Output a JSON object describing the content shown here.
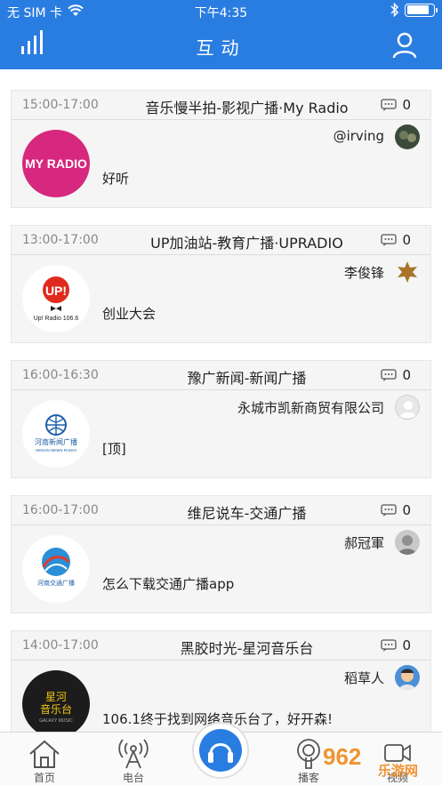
{
  "status": {
    "carrier": "无 SIM 卡",
    "time": "下午4:35"
  },
  "nav": {
    "title": "互动",
    "left_icon": "signal-bars-icon",
    "right_icon": "user-icon"
  },
  "colors": {
    "brand": "#2a7de0",
    "card_bg": "#f5f5f5"
  },
  "posts": [
    {
      "time": "15:00-17:00",
      "title": "音乐慢半拍-影视广播·My Radio",
      "comments": "0",
      "user": "@irving",
      "message": "好听",
      "logo": "my-radio-logo"
    },
    {
      "time": "13:00-17:00",
      "title": "UP加油站-教育广播·UPRADIO",
      "comments": "0",
      "user": "李俊锋",
      "message": "创业大会",
      "logo": "up-radio-logo"
    },
    {
      "time": "16:00-16:30",
      "title": "豫广新闻-新闻广播",
      "comments": "0",
      "user": "永城市凯新商贸有限公司",
      "message": "[顶]",
      "logo": "henan-news-radio-logo"
    },
    {
      "time": "16:00-17:00",
      "title": "维尼说车-交通广播",
      "comments": "0",
      "user": "郝冠軍",
      "message": "怎么下载交通广播app",
      "logo": "henan-traffic-radio-logo"
    },
    {
      "time": "14:00-17:00",
      "title": "黑胶时光-星河音乐台",
      "comments": "0",
      "user": "稻草人",
      "message": "106.1终于找到网络音乐台了，好开森!",
      "logo": "galaxy-music-logo"
    }
  ],
  "logos": {
    "my_radio": "MY RADIO",
    "up_radio": "UP!",
    "up_radio_sub": "Up! Radio 106.6",
    "henan_news": "河南新闻广播",
    "henan_news_en": "HENAN NEWS RADIO",
    "henan_traffic": "河南交通广播",
    "galaxy_line1": "星河",
    "galaxy_line2": "音乐台",
    "galaxy_en": "GALAXY MUSIC"
  },
  "tabs": [
    {
      "label": "首页",
      "icon": "home-icon"
    },
    {
      "label": "电台",
      "icon": "radio-tower-icon"
    },
    {
      "label": "",
      "icon": "headphones-center-icon"
    },
    {
      "label": "播客",
      "icon": "podcast-icon"
    },
    {
      "label": "视频",
      "icon": "video-icon"
    }
  ],
  "watermark": "962 乐游网"
}
